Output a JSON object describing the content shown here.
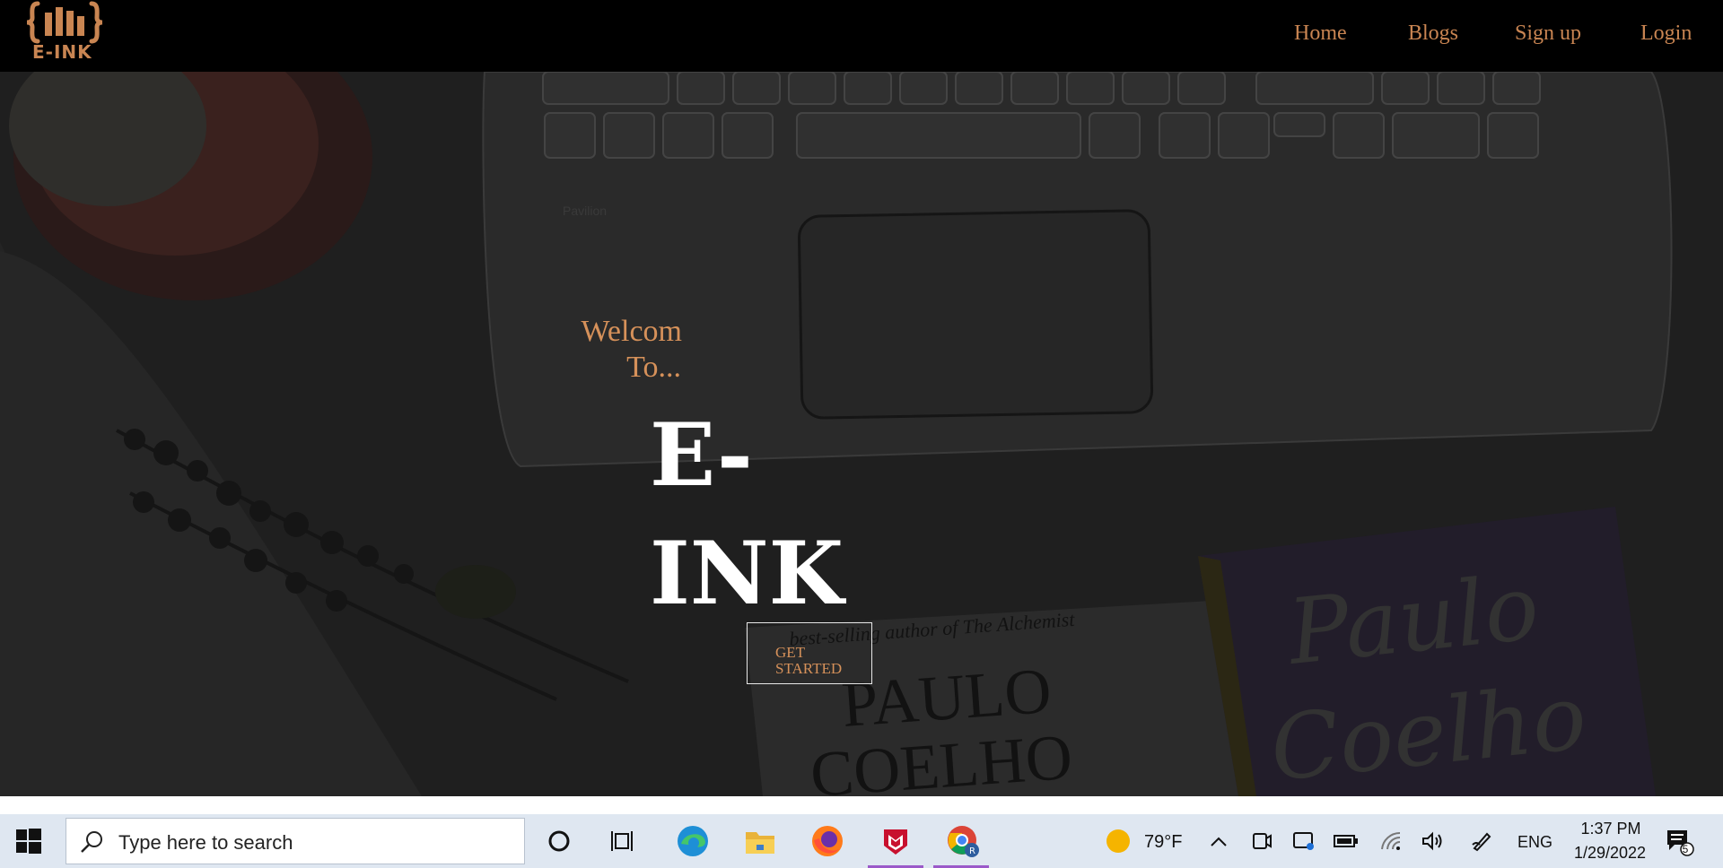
{
  "nav": {
    "logo_text": "E-INK",
    "links": [
      {
        "label": "Home"
      },
      {
        "label": "Blogs"
      },
      {
        "label": "Sign up"
      },
      {
        "label": "Login"
      }
    ]
  },
  "hero": {
    "welcome_line1": "Welcom",
    "welcome_line2": "To...",
    "brand_line1": "E-",
    "brand_line2": "INK",
    "cta_line1": "GET",
    "cta_line2": "STARTED"
  },
  "background_text": {
    "book_author_line": "best-selling author of The Alchemist",
    "book_name": "PAULO",
    "book_name2": "COELHO",
    "book_cover_script1": "Paulo",
    "book_cover_script2": "Coelho",
    "laptop_brand": "Pavilion"
  },
  "taskbar": {
    "search_placeholder": "Type here to search",
    "weather": "79°F",
    "language": "ENG",
    "time": "1:37 PM",
    "date": "1/29/2022",
    "notification_count": "5"
  },
  "colors": {
    "accent": "#c98552",
    "hero_bg": "#1e1e1e",
    "taskbar_bg": "#dfe7f1"
  }
}
